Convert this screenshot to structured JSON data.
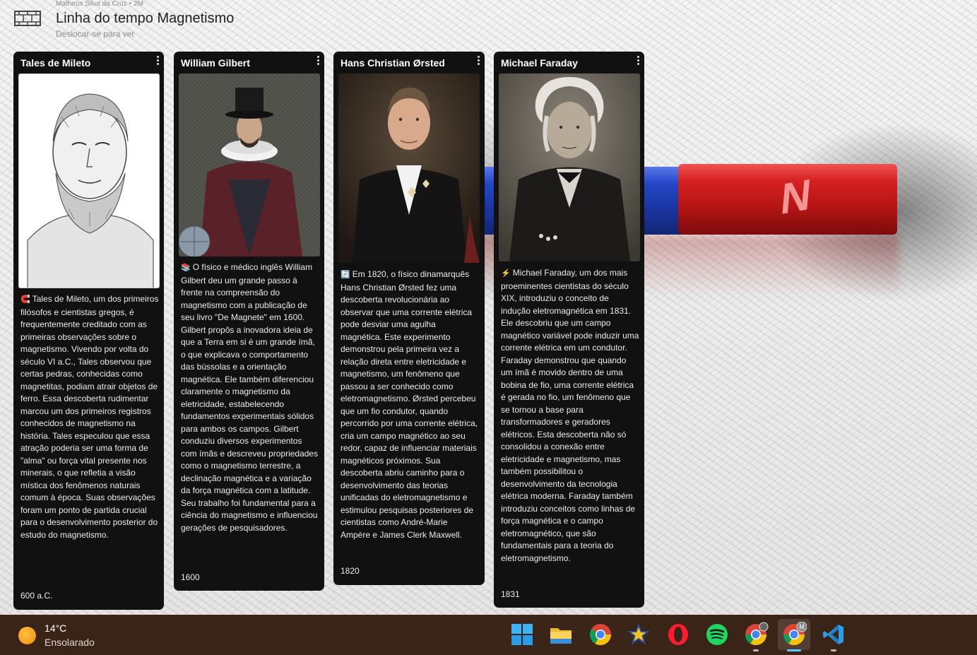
{
  "header": {
    "author": "Matheus Silva da Cruz",
    "time": "2M",
    "title": "Linha do tempo Magnetismo",
    "subtitle": "Deslocar-se para ver"
  },
  "cards": [
    {
      "title": "Tales de Mileto",
      "emoji": "🧲",
      "text": "Tales de Mileto, um dos primeiros filósofos e cientistas gregos, é frequentemente creditado com as primeiras observações sobre o magnetismo. Vivendo por volta do século VI a.C., Tales observou que certas pedras, conhecidas como magnetitas, podiam atrair objetos de ferro. Essa descoberta rudimentar marcou um dos primeiros registros conhecidos de magnetismo na história. Tales especulou que essa atração poderia ser uma forma de \"alma\" ou força vital presente nos minerais, o que refletia a visão mística dos fenômenos naturais comum à época. Suas observações foram um ponto de partida crucial para o desenvolvimento posterior do estudo do magnetismo.",
      "date": "600 a.C."
    },
    {
      "title": "William Gilbert",
      "emoji": "📚",
      "text": "O físico e médico inglês William Gilbert deu um grande passo à frente na compreensão do magnetismo com a publicação de seu livro \"De Magnete\" em 1600. Gilbert propôs a inovadora ideia de que a Terra em si é um grande ímã, o que explicava o comportamento das bússolas e a orientação magnética. Ele também diferenciou claramente o magnetismo da eletricidade, estabelecendo fundamentos experimentais sólidos para ambos os campos. Gilbert conduziu diversos experimentos com ímãs e descreveu propriedades como o magnetismo terrestre, a declinação magnética e a variação da força magnética com a latitude. Seu trabalho foi fundamental para a ciência do magnetismo e influenciou gerações de pesquisadores.",
      "date": "1600"
    },
    {
      "title": "Hans Christian Ørsted",
      "emoji": "🔄",
      "text": "Em 1820, o físico dinamarquês Hans Christian Ørsted fez uma descoberta revolucionária ao observar que uma corrente elétrica pode desviar uma agulha magnética. Este experimento demonstrou pela primeira vez a relação direta entre eletricidade e magnetismo, um fenômeno que passou a ser conhecido como eletromagnetismo. Ørsted percebeu que um fio condutor, quando percorrido por uma corrente elétrica, cria um campo magnético ao seu redor, capaz de influenciar materiais magnéticos próximos. Sua descoberta abriu caminho para o desenvolvimento das teorias unificadas do eletromagnetismo e estimulou pesquisas posteriores de cientistas como André-Marie Ampère e James Clerk Maxwell.",
      "date": "1820"
    },
    {
      "title": "Michael Faraday",
      "emoji": "⚡",
      "text": "Michael Faraday, um dos mais proeminentes cientistas do século XIX, introduziu o conceito de indução eletromagnética em 1831. Ele descobriu que um campo magnético variável pode induzir uma corrente elétrica em um condutor. Faraday demonstrou que quando um ímã é movido dentro de uma bobina de fio, uma corrente elétrica é gerada no fio, um fenômeno que se tornou a base para transformadores e geradores elétricos. Esta descoberta não só consolidou a conexão entre eletricidade e magnetismo, mas também possibilitou o desenvolvimento da tecnologia elétrica moderna. Faraday também introduziu conceitos como linhas de força magnética e o campo eletromagnético, que são fundamentais para a teoria do eletromagnetismo.",
      "date": "1831"
    }
  ],
  "taskbar": {
    "weather": {
      "temp": "14°C",
      "condition": "Ensolarado"
    },
    "apps": [
      {
        "icon": "windows-start-icon"
      },
      {
        "icon": "file-explorer-icon"
      },
      {
        "icon": "chrome-icon"
      },
      {
        "icon": "star-app-icon"
      },
      {
        "icon": "opera-icon"
      },
      {
        "icon": "spotify-icon"
      },
      {
        "icon": "chrome-profile-icon"
      },
      {
        "icon": "chrome-profile-m-icon",
        "badge": "M"
      },
      {
        "icon": "vscode-icon"
      }
    ]
  },
  "colors": {
    "card_bg": "#111111",
    "magnet_red": "#c81b1b",
    "magnet_blue": "#1f3fb8",
    "taskbar_bg": "#3a2418",
    "active_indicator": "#5cc8ff"
  }
}
